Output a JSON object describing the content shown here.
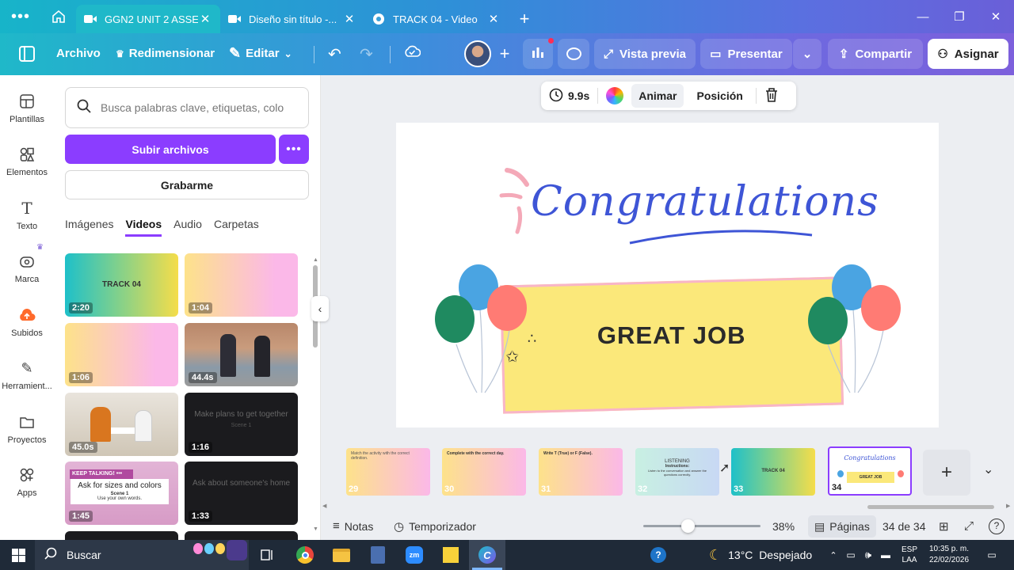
{
  "browser": {
    "tabs": [
      {
        "label": "GGN2 UNIT 2 ASSE...",
        "icon": "video-icon",
        "active": true
      },
      {
        "label": "Diseño sin título -...",
        "icon": "video-icon",
        "active": false
      },
      {
        "label": "TRACK 04 - Video",
        "icon": "canva-icon",
        "active": false
      }
    ]
  },
  "toolbar": {
    "file": "Archivo",
    "resize": "Redimensionar",
    "edit": "Editar",
    "preview": "Vista previa",
    "present": "Presentar",
    "share": "Compartir",
    "assign": "Asignar"
  },
  "rail": [
    {
      "label": "Plantillas",
      "icon": "templates-icon"
    },
    {
      "label": "Elementos",
      "icon": "elements-icon"
    },
    {
      "label": "Texto",
      "icon": "text-icon"
    },
    {
      "label": "Marca",
      "icon": "brand-icon"
    },
    {
      "label": "Subidos",
      "icon": "upload-cloud-icon"
    },
    {
      "label": "Herramient...",
      "icon": "tools-icon"
    },
    {
      "label": "Proyectos",
      "icon": "folder-icon"
    },
    {
      "label": "Apps",
      "icon": "apps-icon"
    }
  ],
  "panel": {
    "search_placeholder": "Busca palabras clave, etiquetas, colo",
    "upload": "Subir archivos",
    "record": "Grabarme",
    "tabs": [
      "Imágenes",
      "Videos",
      "Audio",
      "Carpetas"
    ],
    "active_tab": "Videos",
    "videos": [
      {
        "duration": "2:20",
        "title": "TRACK 04"
      },
      {
        "duration": "1:04",
        "title": ""
      },
      {
        "duration": "1:06",
        "title": ""
      },
      {
        "duration": "44.4s",
        "title": ""
      },
      {
        "duration": "45.0s",
        "title": ""
      },
      {
        "duration": "1:16",
        "title": "Make plans to get together",
        "sub": "Scene 1"
      },
      {
        "duration": "1:45",
        "title": "Ask for sizes and colors",
        "banner": "KEEP TALKING!",
        "sub": "Scene 1",
        "sub2": "Use your own words."
      },
      {
        "duration": "1:33",
        "title": "Ask about someone's home"
      }
    ]
  },
  "context": {
    "duration": "9.9s",
    "animate": "Animar",
    "position": "Posición"
  },
  "slide": {
    "heading": "Congratulations",
    "banner": "GREAT JOB"
  },
  "filmstrip": [
    {
      "n": "29",
      "title": "Match the activity with the correct definition."
    },
    {
      "n": "30",
      "title": "Complete with the correct day."
    },
    {
      "n": "31",
      "title": "Write T (True) or F (False)."
    },
    {
      "n": "32",
      "title": "LISTENING",
      "sub": "Instructions:",
      "sub2": "Listen to the conversation and answer the questions correctly."
    },
    {
      "n": "33",
      "title": "TRACK 04"
    },
    {
      "n": "34",
      "title": "Congratulations",
      "sub": "GREAT JOB"
    }
  ],
  "bottom": {
    "notes": "Notas",
    "timer": "Temporizador",
    "zoom": "38%",
    "zoom_fraction": 0.38,
    "pages": "Páginas",
    "page_count": "34 de 34"
  },
  "taskbar": {
    "search": "Buscar",
    "weather": "13°C  Despejado",
    "lang1": "ESP",
    "lang2": "LAA",
    "time": "10:35 p. m.",
    "date": "22/02/2026"
  }
}
